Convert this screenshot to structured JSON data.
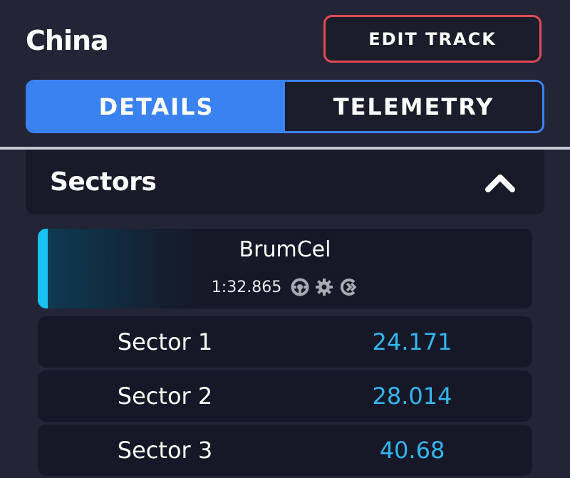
{
  "header": {
    "track_name": "China",
    "edit_button_label": "EDIT TRACK"
  },
  "tabs": [
    {
      "label": "DETAILS",
      "active": true
    },
    {
      "label": "TELEMETRY",
      "active": false
    }
  ],
  "sectors_panel": {
    "title": "Sectors",
    "expanded": true,
    "icon": "chevron-up-icon"
  },
  "lap": {
    "driver": "BrumCel",
    "time": "1:32.865",
    "accent_color": "#19c2f2",
    "icons": [
      "steering-wheel-icon",
      "gear-icon",
      "traction-control-icon"
    ]
  },
  "sectors": [
    {
      "name": "Sector 1",
      "time": "24.171"
    },
    {
      "name": "Sector 2",
      "time": "28.014"
    },
    {
      "name": "Sector 3",
      "time": "40.68"
    }
  ],
  "colors": {
    "background": "#232536",
    "accent_blue": "#3b82f1",
    "edit_border": "#e04a55",
    "time_color": "#34b6ee"
  }
}
